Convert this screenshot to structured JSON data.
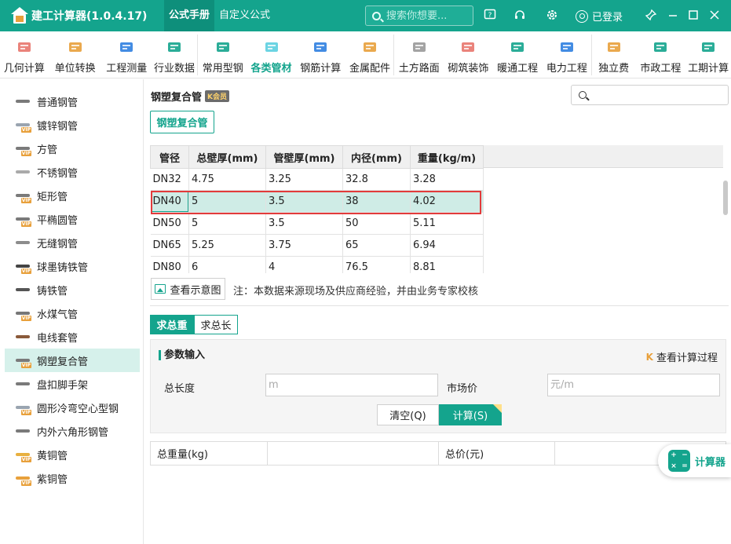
{
  "app": {
    "title": "建工计算器(1.0.4.17)"
  },
  "menu": {
    "tabs": [
      {
        "label": "公式手册",
        "active": true
      },
      {
        "label": "自定义公式",
        "active": false
      }
    ]
  },
  "search": {
    "placeholder": "搜索你想要..."
  },
  "titlebar_icons": [
    "feedback-icon",
    "headset-icon",
    "gear-icon"
  ],
  "login": {
    "label": "已登录"
  },
  "window_controls": [
    "pin-icon",
    "minimize-icon",
    "maximize-icon",
    "close-icon"
  ],
  "ribbon": {
    "items": [
      {
        "label": "几何计算",
        "icon": "cube-icon",
        "color": "#e8766d",
        "w": 62
      },
      {
        "label": "单位转换",
        "icon": "cm-icon",
        "color": "#e8a03b",
        "w": 68
      },
      {
        "label": "工程测量",
        "icon": "ruler-axis-icon",
        "color": "#2f7fe0",
        "w": 64
      },
      {
        "label": "行业数据",
        "icon": "bar-chart-icon",
        "color": "#14a48d",
        "w": 58
      },
      {
        "label": "常用型钢",
        "icon": "wrench-icon",
        "color": "#14a48d",
        "w": 64
      },
      {
        "label": "各类管材",
        "icon": "pipe-icon",
        "color": "#5ccfe0",
        "w": 60,
        "selected": true
      },
      {
        "label": "钢筋计算",
        "icon": "rebar-icon",
        "color": "#2f7fe0",
        "w": 66
      },
      {
        "label": "金属配件",
        "icon": "fitting-icon",
        "color": "#e8a03b",
        "w": 60
      },
      {
        "label": "土方路面",
        "icon": "road-icon",
        "color": "#999999",
        "w": 64
      },
      {
        "label": "砌筑装饰",
        "icon": "brick-icon",
        "color": "#e8766d",
        "w": 62
      },
      {
        "label": "暖通工程",
        "icon": "fan-icon",
        "color": "#14a48d",
        "w": 64
      },
      {
        "label": "电力工程",
        "icon": "house-power-icon",
        "color": "#2f7fe0",
        "w": 62
      },
      {
        "label": "独立费",
        "icon": "fee-chart-icon",
        "color": "#e8a03b",
        "w": 56
      },
      {
        "label": "市政工程",
        "icon": "streetlight-icon",
        "color": "#14a48d",
        "w": 64
      },
      {
        "label": "工期计算",
        "icon": "calendar-icon",
        "color": "#14a48d",
        "w": 58
      }
    ]
  },
  "sidebar": {
    "items": [
      {
        "label": "普通钢管",
        "icon": "steel-pipe-icon",
        "color": "#7a7a7a",
        "vip": false
      },
      {
        "label": "镀锌钢管",
        "icon": "galvanized-pipe-icon",
        "color": "#9aa4b0",
        "vip": true
      },
      {
        "label": "方管",
        "icon": "square-tube-icon",
        "color": "#7a7a7a",
        "vip": true
      },
      {
        "label": "不锈钢管",
        "icon": "stainless-pipe-icon",
        "color": "#aaaaaa",
        "vip": false
      },
      {
        "label": "矩形管",
        "icon": "rect-tube-icon",
        "color": "#7a7a7a",
        "vip": true
      },
      {
        "label": "平椭圆管",
        "icon": "oval-tube-icon",
        "color": "#7a7a7a",
        "vip": true
      },
      {
        "label": "无缝钢管",
        "icon": "seamless-pipe-icon",
        "color": "#8c8c8c",
        "vip": false
      },
      {
        "label": "球墨铸铁管",
        "icon": "ductile-iron-pipe-icon",
        "color": "#444444",
        "vip": true
      },
      {
        "label": "铸铁管",
        "icon": "cast-iron-pipe-icon",
        "color": "#555555",
        "vip": false
      },
      {
        "label": "水煤气管",
        "icon": "gas-pipe-icon",
        "color": "#777777",
        "vip": true
      },
      {
        "label": "电线套管",
        "icon": "conduit-icon",
        "color": "#8a5a3a",
        "vip": false
      },
      {
        "label": "钢塑复合管",
        "icon": "steel-plastic-pipe-icon",
        "color": "#7a7a7a",
        "vip": true,
        "selected": true
      },
      {
        "label": "盘扣脚手架",
        "icon": "scaffold-icon",
        "color": "#7a7a7a",
        "vip": false
      },
      {
        "label": "圆形冷弯空心型钢",
        "icon": "round-hollow-steel-icon",
        "color": "#9aa4b0",
        "vip": true
      },
      {
        "label": "内外六角形钢管",
        "icon": "hexagon-pipe-icon",
        "color": "#7a7a7a",
        "vip": false
      },
      {
        "label": "黄铜管",
        "icon": "brass-pipe-icon",
        "color": "#e8b040",
        "vip": true
      },
      {
        "label": "紫铜管",
        "icon": "copper-pipe-icon",
        "color": "#e8a03b",
        "vip": true
      }
    ]
  },
  "content": {
    "title": "钢塑复合管",
    "vip_badge": "K会员",
    "type_button": "钢塑复合管",
    "view_diagram": "查看示意图",
    "note": "注：本数据来源现场及供应商经验，并由业务专家校核"
  },
  "table": {
    "headers": [
      "管径",
      "总壁厚(mm)",
      "管壁厚(mm)",
      "内径(mm)",
      "重量(kg/m)"
    ],
    "rows": [
      [
        "DN32",
        "4.75",
        "3.25",
        "32.8",
        "3.28"
      ],
      [
        "DN40",
        "5",
        "3.5",
        "38",
        "4.02"
      ],
      [
        "DN50",
        "5",
        "3.5",
        "50",
        "5.11"
      ],
      [
        "DN65",
        "5.25",
        "3.75",
        "65",
        "6.94"
      ],
      [
        "DN80",
        "6",
        "4",
        "76.5",
        "8.81"
      ]
    ],
    "selected_row": 1
  },
  "mode": {
    "tabs": [
      "求总重",
      "求总长"
    ],
    "active": 0
  },
  "params": {
    "title": "参数输入",
    "process_link": "查看计算过程",
    "length_label": "总长度",
    "length_placeholder": "m",
    "price_label": "市场价",
    "price_placeholder": "元/m",
    "clear_button": "清空(Q)",
    "calc_button": "计算(S)"
  },
  "results": {
    "weight_label": "总重量(kg)",
    "weight_value": "",
    "price_label": "总价(元)",
    "price_value": ""
  },
  "floating": {
    "label": "计算器"
  },
  "colors": {
    "accent": "#14a48d",
    "highlight_border": "#e23b3b"
  }
}
